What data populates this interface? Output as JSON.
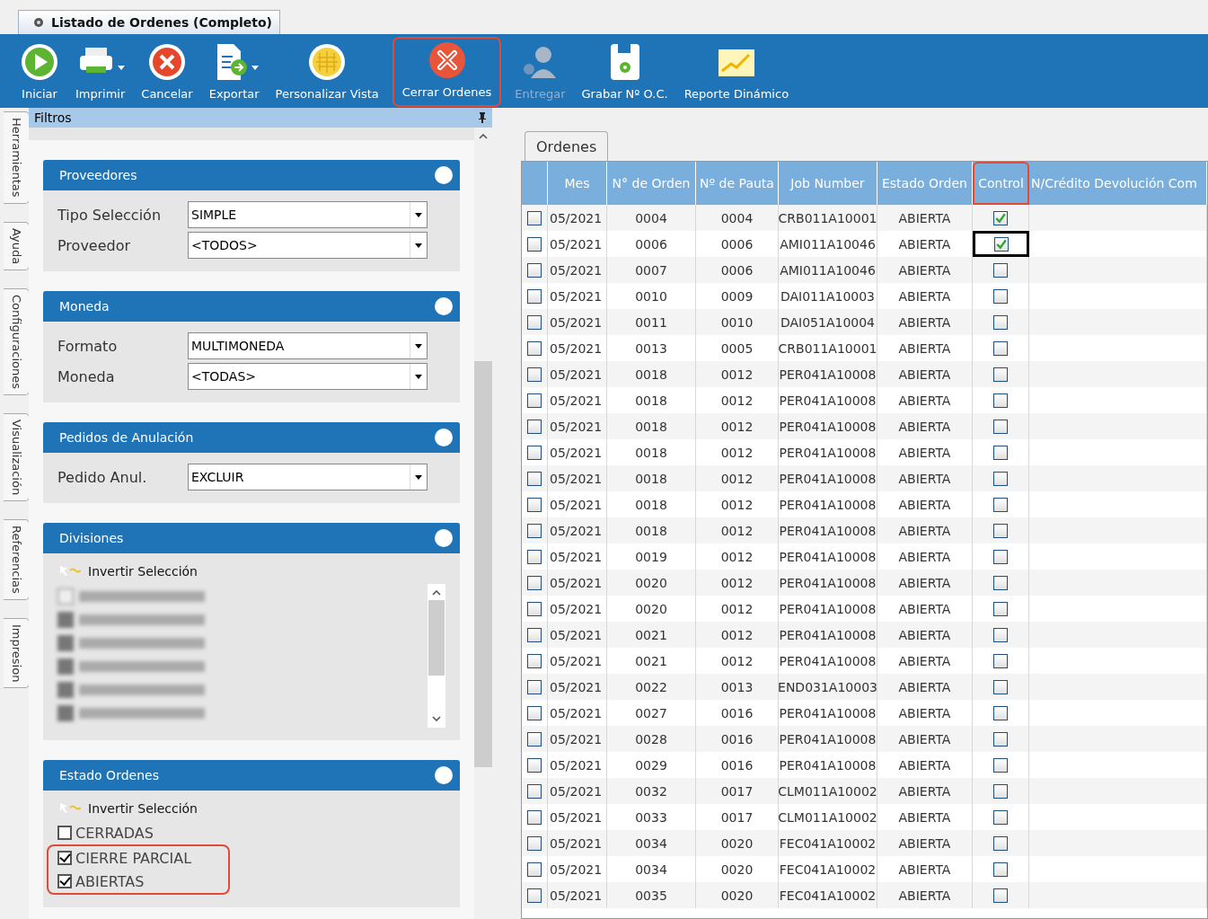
{
  "window": {
    "title": "Listado de Ordenes (Completo)"
  },
  "toolbar": [
    {
      "label": "Iniciar",
      "kind": "play",
      "dropdown": false,
      "disabled": false,
      "highlighted": false
    },
    {
      "label": "Imprimir",
      "kind": "printer",
      "dropdown": true,
      "disabled": false,
      "highlighted": false
    },
    {
      "label": "Cancelar",
      "kind": "cancel",
      "dropdown": false,
      "disabled": false,
      "highlighted": false
    },
    {
      "label": "Exportar",
      "kind": "export",
      "dropdown": true,
      "disabled": false,
      "highlighted": false
    },
    {
      "label": "Personalizar Vista",
      "kind": "grid",
      "dropdown": false,
      "disabled": false,
      "highlighted": false
    },
    {
      "label": "Cerrar Ordenes",
      "kind": "close",
      "dropdown": false,
      "disabled": false,
      "highlighted": true
    },
    {
      "label": "Entregar",
      "kind": "user",
      "dropdown": false,
      "disabled": true,
      "highlighted": false
    },
    {
      "label": "Grabar Nº O.C.",
      "kind": "floppy",
      "dropdown": false,
      "disabled": false,
      "highlighted": false
    },
    {
      "label": "Reporte Dinámico",
      "kind": "chart",
      "dropdown": false,
      "disabled": false,
      "highlighted": false
    }
  ],
  "side_tabs": [
    "Herramientas",
    "Ayuda",
    "Configuraciones",
    "Visualización",
    "Referencias",
    "Impresion"
  ],
  "filters": {
    "title": "Filtros",
    "sections": [
      {
        "title": "Proveedores",
        "kind": "fields",
        "fields": [
          {
            "label": "Tipo Selección",
            "value": "SIMPLE"
          },
          {
            "label": "Proveedor",
            "value": "<TODOS>"
          }
        ]
      },
      {
        "title": "Moneda",
        "kind": "fields",
        "fields": [
          {
            "label": "Formato",
            "value": "MULTIMONEDA"
          },
          {
            "label": "Moneda",
            "value": "<TODAS>"
          }
        ]
      },
      {
        "title": "Pedidos de Anulación",
        "kind": "fields",
        "fields": [
          {
            "label": "Pedido Anul.",
            "value": "EXCLUIR"
          }
        ]
      },
      {
        "title": "Divisiones",
        "kind": "blurred",
        "invert": "Invertir Selección",
        "items": [
          {
            "checked": false
          },
          {
            "checked": true
          },
          {
            "checked": true
          },
          {
            "checked": true
          },
          {
            "checked": true
          },
          {
            "checked": true
          }
        ]
      },
      {
        "title": "Estado Ordenes",
        "kind": "checks",
        "invert": "Invertir Selección",
        "items": [
          {
            "label": "CERRADAS",
            "checked": false,
            "highlighted": false
          },
          {
            "label": "CIERRE PARCIAL",
            "checked": true,
            "highlighted": true
          },
          {
            "label": "ABIERTAS",
            "checked": true,
            "highlighted": true
          }
        ]
      }
    ]
  },
  "orders": {
    "tab": "Ordenes",
    "columns": [
      {
        "label": "Mes",
        "highlighted": false
      },
      {
        "label": "N° de Orden",
        "highlighted": false
      },
      {
        "label": "Nº de Pauta",
        "highlighted": false
      },
      {
        "label": "Job Number",
        "highlighted": false
      },
      {
        "label": "Estado Orden",
        "highlighted": false
      },
      {
        "label": "Control",
        "highlighted": true
      },
      {
        "label": "N/Crédito Devolución Com",
        "highlighted": false
      }
    ],
    "rows": [
      {
        "selected": false,
        "mes": "05/2021",
        "orden": "0004",
        "pauta": "0004",
        "job": "CRB011A10001",
        "estado": "ABIERTA",
        "control": true,
        "focused": false
      },
      {
        "selected": false,
        "mes": "05/2021",
        "orden": "0006",
        "pauta": "0006",
        "job": "AMI011A10046",
        "estado": "ABIERTA",
        "control": true,
        "focused": true
      },
      {
        "selected": false,
        "mes": "05/2021",
        "orden": "0007",
        "pauta": "0006",
        "job": "AMI011A10046",
        "estado": "ABIERTA",
        "control": false,
        "focused": false
      },
      {
        "selected": false,
        "mes": "05/2021",
        "orden": "0010",
        "pauta": "0009",
        "job": "DAI011A10003",
        "estado": "ABIERTA",
        "control": false,
        "focused": false
      },
      {
        "selected": false,
        "mes": "05/2021",
        "orden": "0011",
        "pauta": "0010",
        "job": "DAI051A10004",
        "estado": "ABIERTA",
        "control": false,
        "focused": false
      },
      {
        "selected": false,
        "mes": "05/2021",
        "orden": "0013",
        "pauta": "0005",
        "job": "CRB011A10001",
        "estado": "ABIERTA",
        "control": false,
        "focused": false
      },
      {
        "selected": false,
        "mes": "05/2021",
        "orden": "0018",
        "pauta": "0012",
        "job": "PER041A10008",
        "estado": "ABIERTA",
        "control": false,
        "focused": false
      },
      {
        "selected": false,
        "mes": "05/2021",
        "orden": "0018",
        "pauta": "0012",
        "job": "PER041A10008",
        "estado": "ABIERTA",
        "control": false,
        "focused": false
      },
      {
        "selected": false,
        "mes": "05/2021",
        "orden": "0018",
        "pauta": "0012",
        "job": "PER041A10008",
        "estado": "ABIERTA",
        "control": false,
        "focused": false
      },
      {
        "selected": false,
        "mes": "05/2021",
        "orden": "0018",
        "pauta": "0012",
        "job": "PER041A10008",
        "estado": "ABIERTA",
        "control": false,
        "focused": false
      },
      {
        "selected": false,
        "mes": "05/2021",
        "orden": "0018",
        "pauta": "0012",
        "job": "PER041A10008",
        "estado": "ABIERTA",
        "control": false,
        "focused": false
      },
      {
        "selected": false,
        "mes": "05/2021",
        "orden": "0018",
        "pauta": "0012",
        "job": "PER041A10008",
        "estado": "ABIERTA",
        "control": false,
        "focused": false
      },
      {
        "selected": false,
        "mes": "05/2021",
        "orden": "0018",
        "pauta": "0012",
        "job": "PER041A10008",
        "estado": "ABIERTA",
        "control": false,
        "focused": false
      },
      {
        "selected": false,
        "mes": "05/2021",
        "orden": "0019",
        "pauta": "0012",
        "job": "PER041A10008",
        "estado": "ABIERTA",
        "control": false,
        "focused": false
      },
      {
        "selected": false,
        "mes": "05/2021",
        "orden": "0020",
        "pauta": "0012",
        "job": "PER041A10008",
        "estado": "ABIERTA",
        "control": false,
        "focused": false
      },
      {
        "selected": false,
        "mes": "05/2021",
        "orden": "0020",
        "pauta": "0012",
        "job": "PER041A10008",
        "estado": "ABIERTA",
        "control": false,
        "focused": false
      },
      {
        "selected": false,
        "mes": "05/2021",
        "orden": "0021",
        "pauta": "0012",
        "job": "PER041A10008",
        "estado": "ABIERTA",
        "control": false,
        "focused": false
      },
      {
        "selected": false,
        "mes": "05/2021",
        "orden": "0021",
        "pauta": "0012",
        "job": "PER041A10008",
        "estado": "ABIERTA",
        "control": false,
        "focused": false
      },
      {
        "selected": false,
        "mes": "05/2021",
        "orden": "0022",
        "pauta": "0013",
        "job": "END031A10003",
        "estado": "ABIERTA",
        "control": false,
        "focused": false
      },
      {
        "selected": false,
        "mes": "05/2021",
        "orden": "0027",
        "pauta": "0016",
        "job": "PER041A10008",
        "estado": "ABIERTA",
        "control": false,
        "focused": false
      },
      {
        "selected": false,
        "mes": "05/2021",
        "orden": "0028",
        "pauta": "0016",
        "job": "PER041A10008",
        "estado": "ABIERTA",
        "control": false,
        "focused": false
      },
      {
        "selected": false,
        "mes": "05/2021",
        "orden": "0029",
        "pauta": "0016",
        "job": "PER041A10008",
        "estado": "ABIERTA",
        "control": false,
        "focused": false
      },
      {
        "selected": false,
        "mes": "05/2021",
        "orden": "0032",
        "pauta": "0017",
        "job": "CLM011A10002",
        "estado": "ABIERTA",
        "control": false,
        "focused": false
      },
      {
        "selected": false,
        "mes": "05/2021",
        "orden": "0033",
        "pauta": "0017",
        "job": "CLM011A10002",
        "estado": "ABIERTA",
        "control": false,
        "focused": false
      },
      {
        "selected": false,
        "mes": "05/2021",
        "orden": "0034",
        "pauta": "0020",
        "job": "FEC041A10002",
        "estado": "ABIERTA",
        "control": false,
        "focused": false
      },
      {
        "selected": false,
        "mes": "05/2021",
        "orden": "0034",
        "pauta": "0020",
        "job": "FEC041A10002",
        "estado": "ABIERTA",
        "control": false,
        "focused": false
      },
      {
        "selected": false,
        "mes": "05/2021",
        "orden": "0035",
        "pauta": "0020",
        "job": "FEC041A10002",
        "estado": "ABIERTA",
        "control": false,
        "focused": false
      }
    ]
  }
}
